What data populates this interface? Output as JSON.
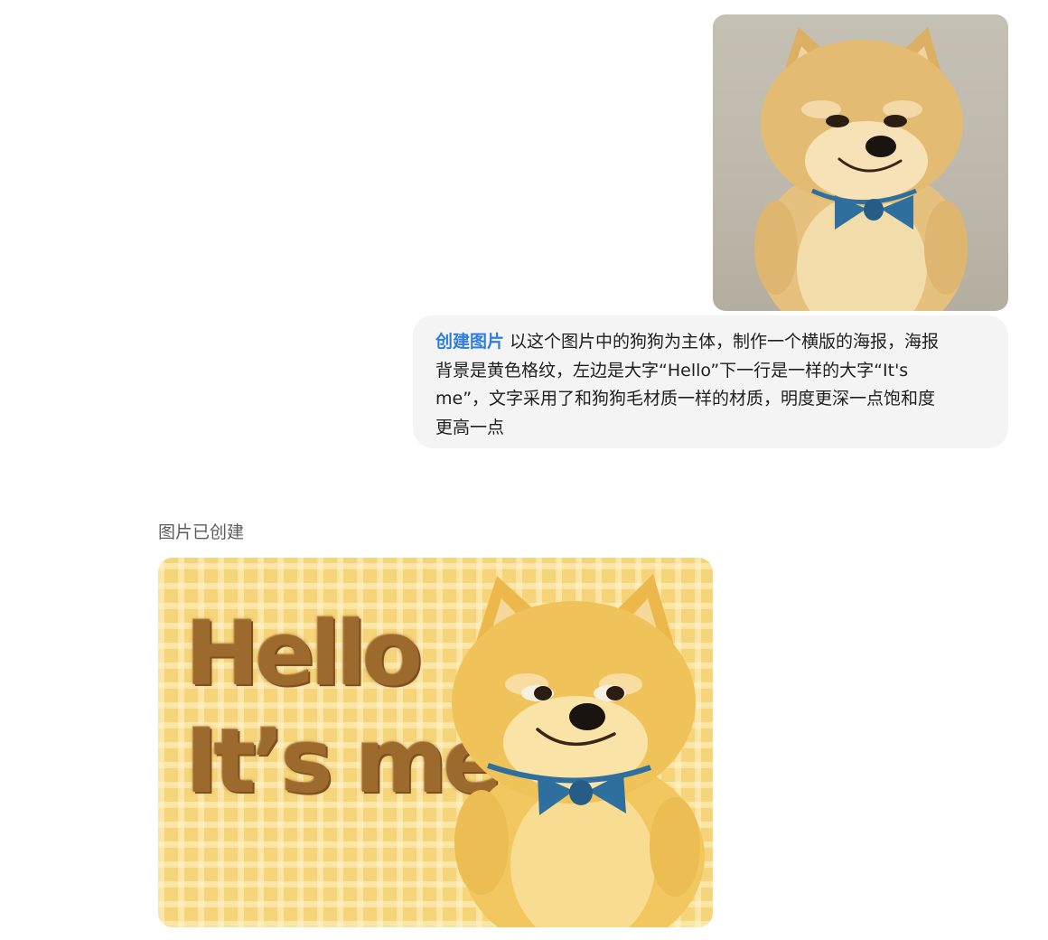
{
  "user_message": {
    "tag": "创建图片",
    "lines": [
      "以这个图片中的狗狗为主体，制作一个横版的海报，海报",
      "背景是黄色格纹，左边是大字“Hello”下一行是一样的大字“It's",
      "me”，文字采用了和狗狗毛材质一样的材质，明度更深一点饱和度",
      "更高一点"
    ]
  },
  "response": {
    "status": "图片已创建",
    "poster": {
      "line1": "Hello",
      "line2": "It’s me"
    }
  },
  "colors": {
    "accent": "#2f7de1",
    "bubble_bg": "#f4f4f4",
    "poster_bg": "#f6d57a",
    "poster_text": "#9d6a2d",
    "bowtie": "#2f6f9f"
  }
}
